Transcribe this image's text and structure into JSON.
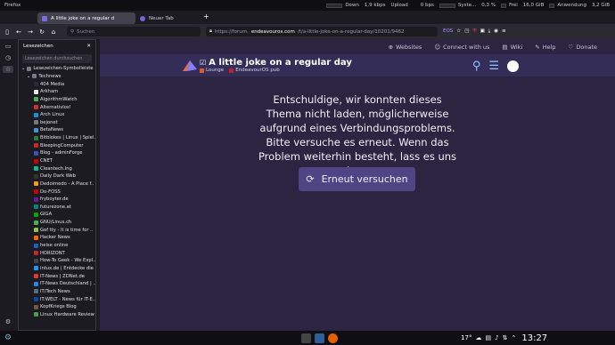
{
  "topbar": {
    "app": "Firefox",
    "down": "Down",
    "down_rate": "1,9 kbps",
    "upload": "Upload",
    "up_rate": "0 bps",
    "system": "Syste...",
    "cpu": "0,3 %",
    "frei": "Frei",
    "frei_val": "16,0 GiB",
    "anw": "Anwendung",
    "anw_val": "3,2 GiB"
  },
  "tabs": [
    {
      "label": "A little joke on a regular d"
    },
    {
      "label": "Neuer Tab"
    }
  ],
  "toolbar": {
    "search_placeholder": "Suchen",
    "url_prefix": "https://forum.",
    "url_domain": "endeavouros.com",
    "url_path": "/t/a-little-joke-on-a-regular-day/10201/9462",
    "badge": "EOS"
  },
  "sidebar": {
    "title": "Lesezeichen",
    "search_placeholder": "Lesezeichen durchsuchen",
    "root": "Lesezeichen-Symbolleiste",
    "folder": "Technews",
    "items": [
      "404 Media",
      "Arkham",
      "AlgorithmWatch",
      "Alternativlos!",
      "Arch Linux",
      "bejonet",
      "BetaNews",
      "Bitblokes | Linux | Spiel..",
      "BleepingComputer",
      "Blog - adminForge",
      "CNET",
      "Cleantech.Ing",
      "Daily Dark Web",
      "Dedoimedo - A Place f..",
      "Do-FOSS",
      "fryboyter.de",
      "futurezone.at",
      "GIGA",
      "GNU/Linux.ch",
      "Gof tty - It is time for ..",
      "Hacker News",
      "heise online",
      "HORIZONT",
      "How-To Geek - We Expl..",
      "intux.de | Entdecke die ..",
      "IT-News | ZDNet.de",
      "IT-News Deutschland | ..",
      "IT/Tech News",
      "IT:WELT - News für IT-E..",
      "KopfKriegs Blog",
      "Linux Hardware Review"
    ]
  },
  "forum": {
    "nav": [
      "Websites",
      "Connect with us",
      "Wiki",
      "Help",
      "Donate"
    ],
    "title": "A little joke on a regular day",
    "cat1": "Lounge",
    "cat2": "EndeavourOS pub",
    "error": "Entschuldige, wir konnten dieses Thema nicht laden, möglicherweise aufgrund eines Verbindungsproblems. Bitte versuche es erneut. Wenn das Problem weiterhin besteht, lass es uns wissen.",
    "retry": "Erneut versuchen"
  },
  "taskbar": {
    "temp": "17°",
    "time": "13:27"
  }
}
